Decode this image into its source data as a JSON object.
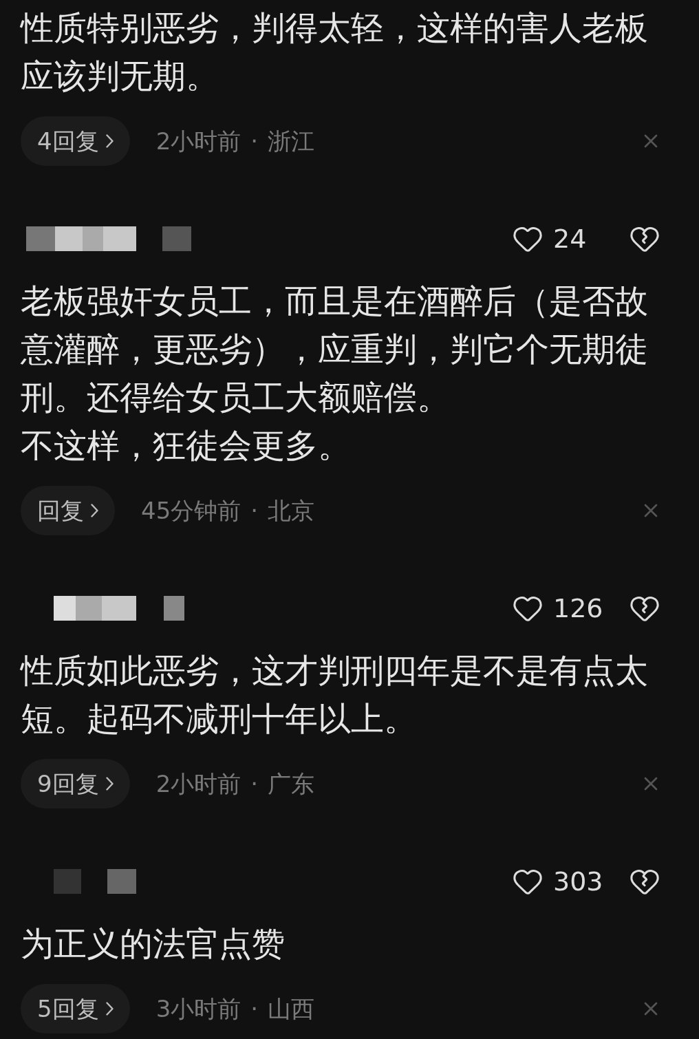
{
  "comments": [
    {
      "paragraphs": [
        "性质特别恶劣，判得太轻，这样的害人老板应该判无期。"
      ],
      "reply_button": "4回复",
      "time": "2小时前",
      "separator": "·",
      "location": "浙江"
    },
    {
      "likes": "24",
      "paragraphs": [
        "老板强奸女员工，而且是在酒醉后（是否故意灌醉，更恶劣），应重判，判它个无期徒刑。还得给女员工大额赔偿。",
        "不这样，狂徒会更多。"
      ],
      "reply_button": "回复",
      "time": "45分钟前",
      "separator": "·",
      "location": "北京"
    },
    {
      "likes": "126",
      "paragraphs": [
        "性质如此恶劣，这才判刑四年是不是有点太短。起码不减刑十年以上。"
      ],
      "reply_button": "9回复",
      "time": "2小时前",
      "separator": "·",
      "location": "广东"
    },
    {
      "likes": "303",
      "paragraphs": [
        "为正义的法官点赞"
      ],
      "reply_button": "5回复",
      "time": "3小时前",
      "separator": "·",
      "location": "山西"
    }
  ]
}
